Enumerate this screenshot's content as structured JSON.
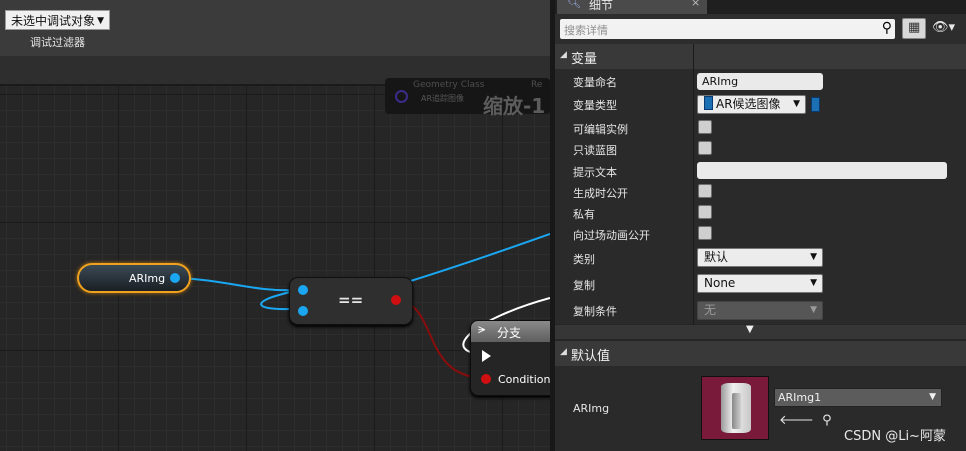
{
  "debug": {
    "object_selector": "未选中调试对象",
    "filter_label": "调试过滤器"
  },
  "graph": {
    "geometry_node": {
      "title": "Geometry Class",
      "subtitle": "AR追踪图像",
      "extra": "Re",
      "zoom": "缩放-1"
    },
    "variable_node": {
      "label": "ARImg"
    },
    "equal_node": {
      "operator": "=="
    },
    "branch_node": {
      "title": "分支",
      "condition_label": "Condition"
    },
    "colors": {
      "object_pin": "#1aa6f0",
      "bool_pin": "#d01010",
      "exec_wire": "#ffffff",
      "selection": "#f0a21e"
    }
  },
  "details": {
    "tab_title": "细节",
    "close_glyph": "×",
    "search_placeholder": "搜索详情",
    "variable_section": "变量",
    "rows": {
      "name_label": "变量命名",
      "name_value": "ARImg",
      "type_label": "变量类型",
      "type_value": "AR候选图像",
      "instance_editable": "可编辑实例",
      "blueprint_readonly": "只读蓝图",
      "tooltip_label": "提示文本",
      "tooltip_value": "",
      "expose_on_spawn": "生成时公开",
      "private": "私有",
      "expose_cinematics": "向过场动画公开",
      "category_label": "类别",
      "category_value": "默认",
      "replication_label": "复制",
      "replication_value": "None",
      "rep_condition_label": "复制条件",
      "rep_condition_value": "无"
    },
    "default_section": "默认值",
    "default_row": {
      "label": "ARImg",
      "asset": "ARImg1"
    }
  },
  "watermark": "CSDN @Li~阿蒙"
}
